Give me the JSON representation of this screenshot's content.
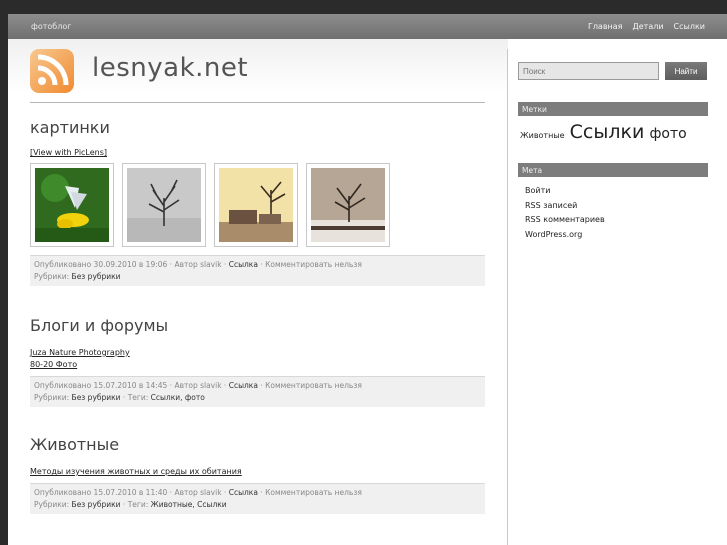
{
  "header": {
    "tagline": "фотоблог",
    "nav": [
      "Главная",
      "Детали",
      "Ссылки"
    ],
    "site_title": "lesnyak.net"
  },
  "posts": [
    {
      "title": "картинки",
      "links": [
        "[View with PicLens]"
      ],
      "thumbnails": [
        "butterfly-on-yellow-flower",
        "lone-tree-in-fog",
        "tree-and-house-at-sunset",
        "tree-in-snowy-field"
      ],
      "meta_line1": {
        "posted": "Опубликовано 30.09.2010 в 19:06 · Автор slavik · ",
        "link": "Ссылка",
        "tail": " · Комментировать нельзя"
      },
      "meta_line2": {
        "prefix": "Рубрики: ",
        "category": "Без рубрики",
        "tags_label": "",
        "tags": ""
      }
    },
    {
      "title": "Блоги и форумы",
      "links": [
        "Juza Nature Photography",
        "80-20 Фото"
      ],
      "meta_line1": {
        "posted": "Опубликовано 15.07.2010 в 14:45 · Автор slavik · ",
        "link": "Ссылка",
        "tail": " · Комментировать нельзя"
      },
      "meta_line2": {
        "prefix": "Рубрики: ",
        "category": "Без рубрики",
        "tags_label": " · Теги: ",
        "tags": "Ссылки, фото"
      }
    },
    {
      "title": "Животные",
      "links": [
        "Методы изучения животных и среды их обитания"
      ],
      "meta_line1": {
        "posted": "Опубликовано 15.07.2010 в 11:40 · Автор slavik · ",
        "link": "Ссылка",
        "tail": " · Комментировать нельзя"
      },
      "meta_line2": {
        "prefix": "Рубрики: ",
        "category": "Без рубрики",
        "tags_label": " · Теги: ",
        "tags": "Животные, Ссылки"
      }
    }
  ],
  "sidebar": {
    "search_placeholder": "Поиск",
    "search_button": "Найти",
    "tags_heading": "Метки",
    "tag_cloud": [
      "Животные",
      "Ссылки",
      "фото"
    ],
    "meta_heading": "Мета",
    "meta_links": [
      "Войти",
      "RSS записей",
      "RSS комментариев",
      "WordPress.org"
    ]
  },
  "colors": {
    "rss_orange": "#f08a30",
    "bar_gray": "#7d7d7d"
  }
}
